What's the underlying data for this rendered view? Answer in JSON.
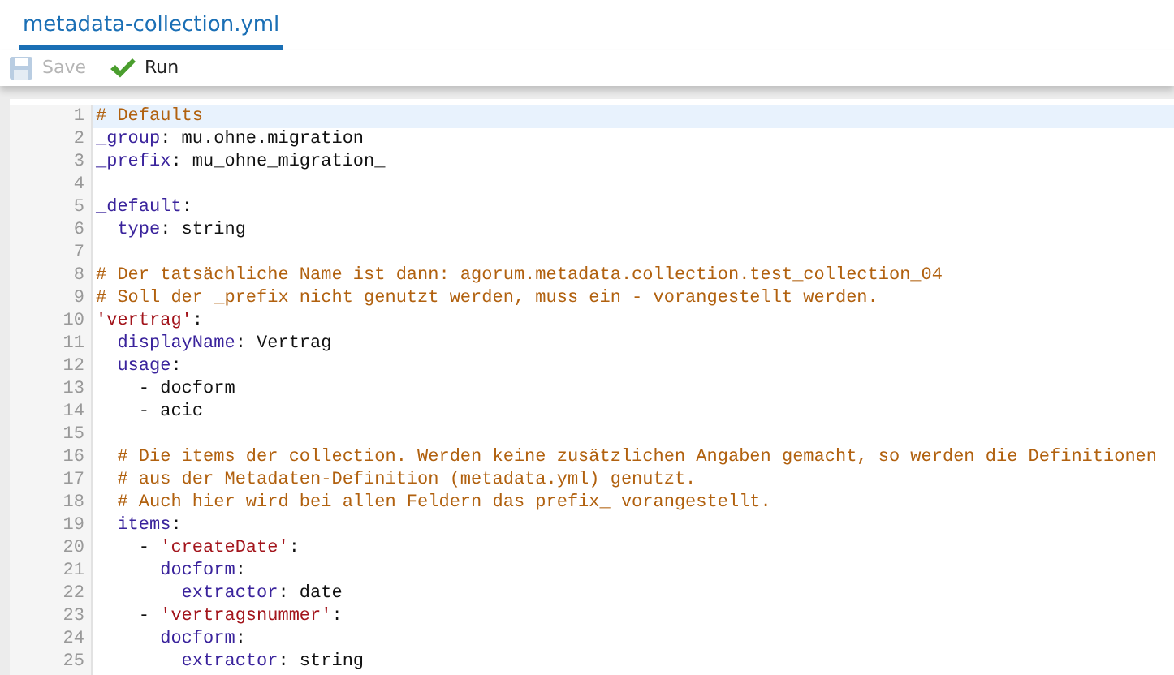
{
  "tabs": [
    {
      "label": "metadata-collection.yml",
      "selected": true
    }
  ],
  "toolbar": [
    {
      "kind": "save",
      "label": "Save",
      "disabled": true
    },
    {
      "kind": "run",
      "label": "Run",
      "disabled": false
    }
  ],
  "editor": {
    "lines": [
      {
        "number": "1",
        "active": true,
        "tokens": [
          {
            "kind": "comment",
            "text": "# Defaults"
          }
        ]
      },
      {
        "number": "2",
        "active": false,
        "tokens": [
          {
            "kind": "key",
            "text": "_group"
          },
          {
            "kind": "plain",
            "text": ": mu.ohne.migration"
          }
        ]
      },
      {
        "number": "3",
        "active": false,
        "tokens": [
          {
            "kind": "key",
            "text": "_prefix"
          },
          {
            "kind": "plain",
            "text": ": mu_ohne_migration_"
          }
        ]
      },
      {
        "number": "4",
        "active": false
      },
      {
        "number": "5",
        "active": false,
        "tokens": [
          {
            "kind": "key",
            "text": "_default"
          },
          {
            "kind": "plain",
            "text": ":"
          }
        ]
      },
      {
        "number": "6",
        "active": false,
        "tokens": [
          {
            "kind": "key",
            "text": "  type"
          },
          {
            "kind": "plain",
            "text": ": string"
          }
        ]
      },
      {
        "number": "7",
        "active": false
      },
      {
        "number": "8",
        "active": false,
        "tokens": [
          {
            "kind": "comment",
            "text": "# Der tatsächliche Name ist dann: agorum.metadata.collection.test_collection_04"
          }
        ]
      },
      {
        "number": "9",
        "active": false,
        "tokens": [
          {
            "kind": "comment",
            "text": "# Soll der _prefix nicht genutzt werden, muss ein - vorangestellt werden."
          }
        ]
      },
      {
        "number": "10",
        "active": false,
        "tokens": [
          {
            "kind": "string",
            "text": "'vertrag'"
          },
          {
            "kind": "plain",
            "text": ":"
          }
        ]
      },
      {
        "number": "11",
        "active": false,
        "tokens": [
          {
            "kind": "key",
            "text": "  displayName"
          },
          {
            "kind": "plain",
            "text": ": Vertrag"
          }
        ]
      },
      {
        "number": "12",
        "active": false,
        "tokens": [
          {
            "kind": "key",
            "text": "  usage"
          },
          {
            "kind": "plain",
            "text": ":"
          }
        ]
      },
      {
        "number": "13",
        "active": false,
        "tokens": [
          {
            "kind": "plain",
            "text": "    - docform"
          }
        ]
      },
      {
        "number": "14",
        "active": false,
        "tokens": [
          {
            "kind": "plain",
            "text": "    - acic"
          }
        ]
      },
      {
        "number": "15",
        "active": false
      },
      {
        "number": "16",
        "active": false,
        "tokens": [
          {
            "kind": "comment",
            "text": "  # Die items der collection. Werden keine zusätzlichen Angaben gemacht, so werden die Definitionen"
          }
        ]
      },
      {
        "number": "17",
        "active": false,
        "tokens": [
          {
            "kind": "comment",
            "text": "  # aus der Metadaten-Definition (metadata.yml) genutzt."
          }
        ]
      },
      {
        "number": "18",
        "active": false,
        "tokens": [
          {
            "kind": "comment",
            "text": "  # Auch hier wird bei allen Feldern das prefix_ vorangestellt."
          }
        ]
      },
      {
        "number": "19",
        "active": false,
        "tokens": [
          {
            "kind": "key",
            "text": "  items"
          },
          {
            "kind": "plain",
            "text": ":"
          }
        ]
      },
      {
        "number": "20",
        "active": false,
        "tokens": [
          {
            "kind": "plain",
            "text": "    - "
          },
          {
            "kind": "string",
            "text": "'createDate'"
          },
          {
            "kind": "plain",
            "text": ":"
          }
        ]
      },
      {
        "number": "21",
        "active": false,
        "tokens": [
          {
            "kind": "key",
            "text": "      docform"
          },
          {
            "kind": "plain",
            "text": ":"
          }
        ]
      },
      {
        "number": "22",
        "active": false,
        "tokens": [
          {
            "kind": "key",
            "text": "        extractor"
          },
          {
            "kind": "plain",
            "text": ": date"
          }
        ]
      },
      {
        "number": "23",
        "active": false,
        "tokens": [
          {
            "kind": "plain",
            "text": "    - "
          },
          {
            "kind": "string",
            "text": "'vertragsnummer'"
          },
          {
            "kind": "plain",
            "text": ":"
          }
        ]
      },
      {
        "number": "24",
        "active": false,
        "tokens": [
          {
            "kind": "key",
            "text": "      docform"
          },
          {
            "kind": "plain",
            "text": ":"
          }
        ]
      },
      {
        "number": "25",
        "active": false,
        "tokens": [
          {
            "kind": "key",
            "text": "        extractor"
          },
          {
            "kind": "plain",
            "text": ": string"
          }
        ]
      }
    ]
  }
}
